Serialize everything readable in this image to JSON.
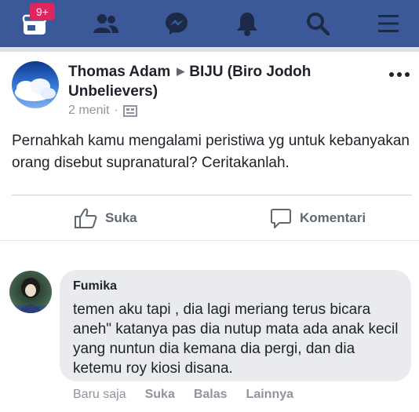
{
  "nav": {
    "badge": "9+",
    "icons": [
      "home-feed-icon",
      "friends-icon",
      "messenger-icon",
      "notifications-bell-icon",
      "search-icon",
      "menu-icon"
    ]
  },
  "post": {
    "author": "Thomas Adam",
    "group": "BIJU (Biro Jodoh Unbelievers)",
    "time": "2 menit",
    "text": "Pernahkah kamu mengalami peristiwa yg untuk kebanyakan orang disebut supranatural? Ceritakanlah.",
    "like_label": "Suka",
    "comment_label": "Komentari"
  },
  "comment": {
    "author": "Fumika",
    "text": "temen aku tapi , dia lagi meriang terus bicara aneh\" katanya pas dia nutup mata ada anak kecil yang nuntun dia kemana dia pergi, dan dia ketemu roy kiosi disana.",
    "time": "Baru saja",
    "like": "Suka",
    "reply": "Balas",
    "more": "Lainnya"
  },
  "colors": {
    "nav_bg": "#3b5998",
    "badge": "#e0245e",
    "bubble": "#e9ebee"
  }
}
